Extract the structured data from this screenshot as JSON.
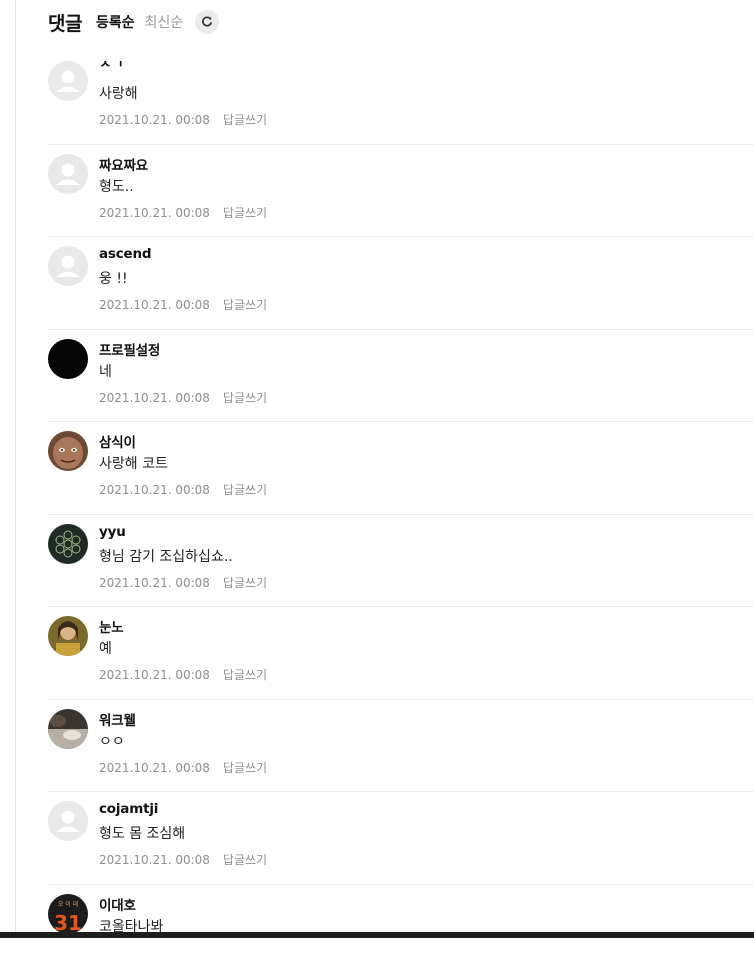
{
  "header": {
    "title": "댓글",
    "sort_registered": "등록순",
    "sort_latest": "최신순",
    "refresh_icon": "refresh-icon"
  },
  "comments": [
    {
      "author": "ㅈㄱ",
      "text": "사랑해",
      "date": "2021.10.21. 00:08",
      "reply": "답글쓰기",
      "avatar": "default"
    },
    {
      "author": "짜요짜요",
      "text": "형도..",
      "date": "2021.10.21. 00:08",
      "reply": "답글쓰기",
      "avatar": "default"
    },
    {
      "author": "ascend",
      "text": "웅 !!",
      "date": "2021.10.21. 00:08",
      "reply": "답글쓰기",
      "avatar": "default"
    },
    {
      "author": "프로필설정",
      "text": "네",
      "date": "2021.10.21. 00:08",
      "reply": "답글쓰기",
      "avatar": "black"
    },
    {
      "author": "삼식이",
      "text": "사랑해 코트",
      "date": "2021.10.21. 00:08",
      "reply": "답글쓰기",
      "avatar": "face"
    },
    {
      "author": "yyu",
      "text": "형님 감기 조십하십쇼..",
      "date": "2021.10.21. 00:08",
      "reply": "답글쓰기",
      "avatar": "pattern"
    },
    {
      "author": "눈노",
      "text": "예",
      "date": "2021.10.21. 00:08",
      "reply": "답글쓰기",
      "avatar": "photo"
    },
    {
      "author": "워크웰",
      "text": "ㅇㅇ",
      "date": "2021.10.21. 00:08",
      "reply": "답글쓰기",
      "avatar": "blur"
    },
    {
      "author": "cojamtji",
      "text": "형도 몸 조심해",
      "date": "2021.10.21. 00:08",
      "reply": "답글쓰기",
      "avatar": "default"
    },
    {
      "author": "이대호",
      "text": "코올타나봐",
      "date": "",
      "reply": "",
      "avatar": "jersey"
    }
  ],
  "jersey_number": "31"
}
